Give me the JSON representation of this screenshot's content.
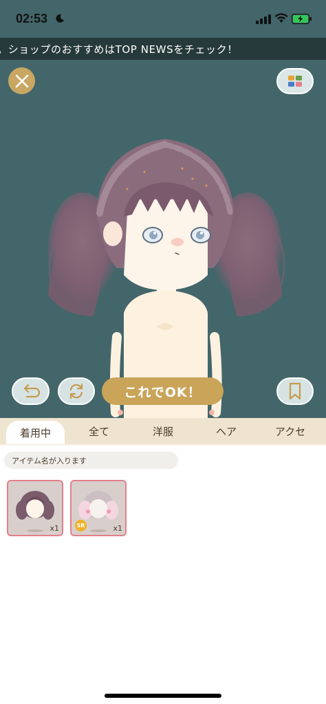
{
  "status_bar": {
    "time": "02:53",
    "icons": [
      "moon-icon",
      "signal-icon",
      "wifi-icon",
      "battery-charging-icon"
    ]
  },
  "ticker": {
    "text": "。ショップのおすすめはTOP NEWSをチェック！"
  },
  "top_buttons": {
    "close_icon": "close-icon",
    "palette_icon": "color-grid-icon"
  },
  "controls": {
    "undo_icon": "undo-icon",
    "reset_icon": "refresh-icon",
    "ok_label": "これでOK！",
    "bookmark_icon": "bookmark-icon"
  },
  "tabs": [
    {
      "label": "着用中",
      "active": true
    },
    {
      "label": "全て",
      "active": false
    },
    {
      "label": "洋服",
      "active": false
    },
    {
      "label": "ヘア",
      "active": false
    },
    {
      "label": "アクセ",
      "active": false
    }
  ],
  "search": {
    "placeholder": "アイテム名が入ります"
  },
  "items": [
    {
      "name": "hair-wavy-mauve",
      "qty": "x1",
      "badge": ""
    },
    {
      "name": "hair-pastel-rainbow",
      "qty": "x1",
      "badge": "SR"
    }
  ],
  "colors": {
    "stage_bg": "#43666a",
    "accent_gold": "#c9a459",
    "tab_bar": "#efe4cf",
    "item_border": "#e57f8a",
    "sr_badge": "#f0b029"
  }
}
